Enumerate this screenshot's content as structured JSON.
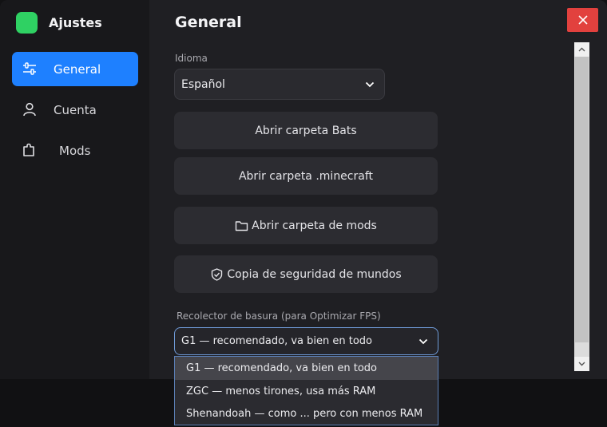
{
  "app": {
    "title": "Ajustes"
  },
  "sidebar": {
    "items": [
      {
        "label": "General",
        "icon": "sliders-icon",
        "active": true
      },
      {
        "label": "Cuenta",
        "icon": "user-icon",
        "active": false
      },
      {
        "label": "Mods",
        "icon": "puzzle-icon",
        "active": false
      }
    ]
  },
  "main": {
    "title": "General",
    "language": {
      "label": "Idioma",
      "value": "Español"
    },
    "buttons": [
      {
        "label": "Abrir carpeta Bats"
      },
      {
        "label": "Abrir carpeta .minecraft"
      },
      {
        "label": "Abrir carpeta de mods",
        "icon": "folder-icon"
      },
      {
        "label": "Copia de seguridad de mundos",
        "icon": "shield-check-icon"
      }
    ],
    "gc": {
      "label": "Recolector de basura (para Optimizar FPS)",
      "value": "G1 — recomendado, va bien en todo",
      "options": [
        "G1 — recomendado, va bien en todo",
        "ZGC — menos tirones, usa más RAM",
        "Shenandoah — como ... pero con menos RAM"
      ]
    }
  },
  "colors": {
    "accent": "#1e80ff",
    "logo": "#2fd163",
    "close": "#e2413e"
  }
}
